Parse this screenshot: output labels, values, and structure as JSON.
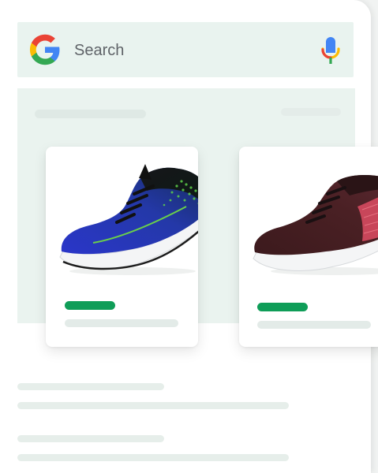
{
  "search": {
    "label": "Search"
  },
  "icons": {
    "logo": "google-g-logo",
    "mic": "microphone-icon"
  },
  "colors": {
    "brand_blue": "#4285f4",
    "brand_red": "#ea4335",
    "brand_yellow": "#fbbc05",
    "brand_green": "#34a853",
    "price_green": "#0f9d58",
    "searchbar_bg": "#e9f3ef"
  },
  "products": [
    {
      "name_image": "blue-running-shoe"
    },
    {
      "name_image": "maroon-running-shoe"
    }
  ]
}
